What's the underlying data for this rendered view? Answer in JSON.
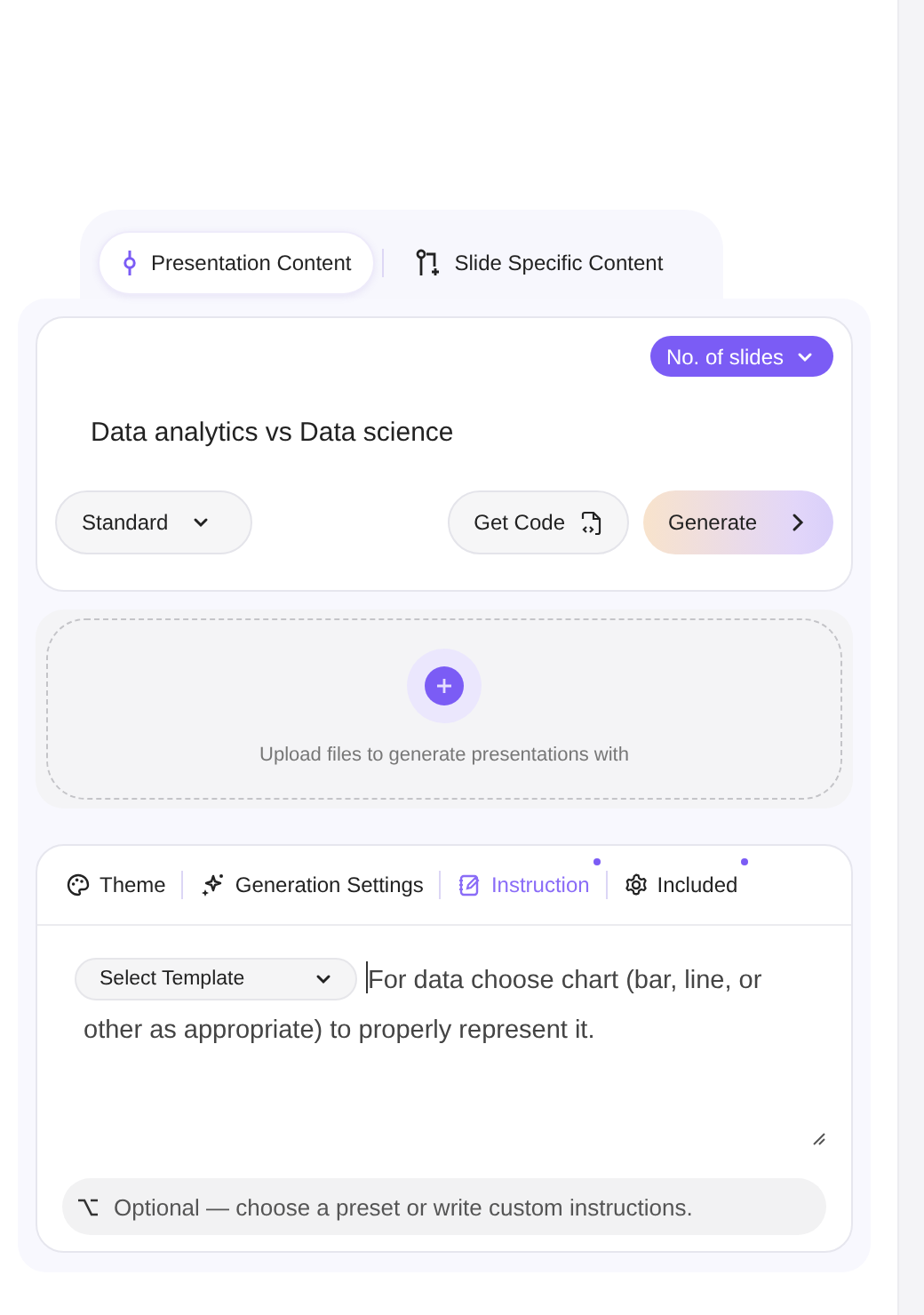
{
  "top_tabs": [
    {
      "label": "Presentation Content",
      "selected": true
    },
    {
      "label": "Slide Specific Content",
      "selected": false
    }
  ],
  "prompt": {
    "slides_button": "No. of slides",
    "value": "Data analytics vs Data science",
    "mode_select": "Standard",
    "get_code_button": "Get Code",
    "generate_button": "Generate"
  },
  "upload": {
    "text": "Upload files to generate presentations with"
  },
  "settings_tabs": [
    {
      "label": "Theme",
      "selected": false,
      "badge": false
    },
    {
      "label": "Generation Settings",
      "selected": false,
      "badge": false
    },
    {
      "label": "Instruction",
      "selected": true,
      "badge": true
    },
    {
      "label": "Included",
      "selected": false,
      "badge": true
    }
  ],
  "instructions": {
    "template_select": "Select Template",
    "value": "For data choose chart (bar, line, or other as appropriate) to properly represent it.",
    "hint": "Optional — choose a preset or write custom instructions."
  }
}
